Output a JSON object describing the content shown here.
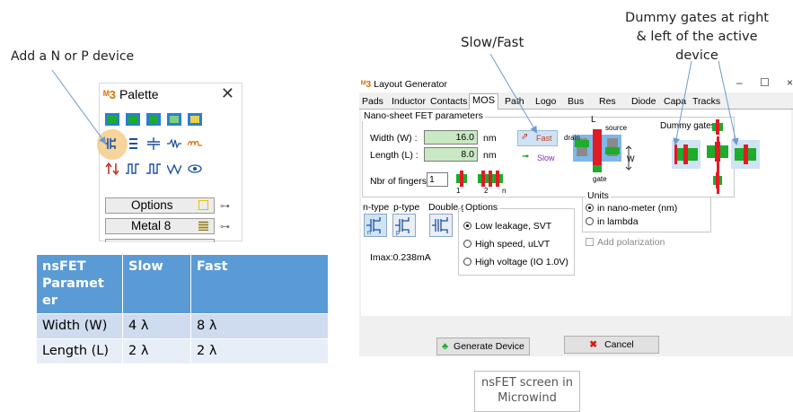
{
  "annotations": {
    "add_device": "Add a N or P device",
    "slow_fast": "Slow/Fast",
    "dummy_line1": "Dummy gates at right",
    "dummy_line2": "& left of the active",
    "dummy_line3": "device"
  },
  "palette": {
    "title": "Palette",
    "options_label": "Options",
    "metal_label": "Metal 8"
  },
  "nsfet_table": {
    "headers": [
      "nsFET Paramet er",
      "Slow",
      "Fast"
    ],
    "rows": [
      [
        "Width (W)",
        "4 λ",
        "8 λ"
      ],
      [
        "Length (L)",
        "2 λ",
        "2 λ"
      ]
    ]
  },
  "window": {
    "title": "Layout Generator",
    "tabs": [
      "Pads",
      "Inductor",
      "Contacts",
      "MOS",
      "Path",
      "Logo",
      "Bus",
      "Res",
      "Diode",
      "Capa",
      "Tracks"
    ],
    "active_tab": "MOS",
    "group_title": "Nano-sheet FET parameters",
    "width_label": "Width (W) :",
    "width_value": "16.0",
    "width_unit": "nm",
    "length_label": "Length (L) :",
    "length_value": "8.0",
    "length_unit": "nm",
    "fingers_label": "Nbr of fingers :",
    "fingers_value": "1",
    "finger_labels": [
      "1",
      "2",
      "n"
    ],
    "fast_label": "Fast",
    "slow_label": "Slow",
    "schematic": {
      "l": "L",
      "source": "source",
      "drain": "drain",
      "w": "W",
      "gate": "gate"
    },
    "dummy_gates_label": "Dummy gates",
    "ntype_label": "n-type",
    "ptype_label": "p-type",
    "double_gate_label": "Double gate",
    "options_title": "Options",
    "options": [
      "Low leakage, SVT",
      "High speed, uLVT",
      "High voltage (IO 1.0V)"
    ],
    "selected_option": 0,
    "imax": "Imax:0.238mA",
    "units_title": "Units",
    "units": [
      "in nano-meter (nm)",
      "in lambda"
    ],
    "add_polarization": "Add polarization",
    "generate_label": "Generate Device",
    "cancel_label": "Cancel"
  },
  "caption": {
    "line1": "nsFET screen in",
    "line2": "Microwind"
  },
  "colors": {
    "header_blue": "#5b9bd5",
    "row_light": "#cfdbee",
    "field_green": "#c9e9c2",
    "poly_red": "#e01b24",
    "diff_green": "#1dac2c"
  }
}
